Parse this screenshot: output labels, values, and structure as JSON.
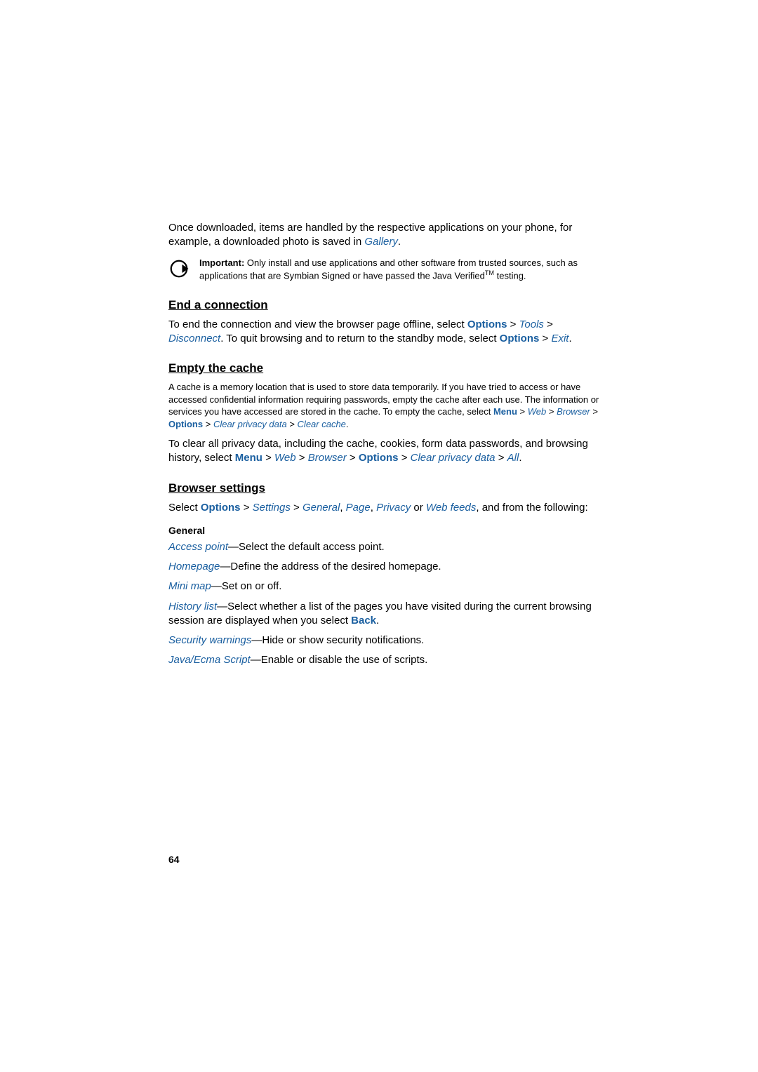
{
  "intro": {
    "line1_pre": "Once downloaded, items are handled by the respective applications on your phone, for example, a downloaded photo is saved in ",
    "gallery": "Gallery",
    "period": "."
  },
  "important_note": {
    "label": "Important:",
    "text": " Only install and use applications and other software from trusted sources, such as applications that are Symbian Signed or have passed the Java Verified",
    "tm": "TM",
    "tail": " testing."
  },
  "end_connection": {
    "heading": "End a connection",
    "pre1": "To end the connection and view the browser page offline, select ",
    "options1": "Options",
    "gt": " > ",
    "tools": "Tools",
    "disconnect": "Disconnect",
    "mid": ". To quit browsing and to return to the standby mode, select ",
    "options2": "Options",
    "exit": "Exit",
    "period": "."
  },
  "empty_cache": {
    "heading": "Empty the cache",
    "para1_pre": "A cache is a memory location that is used to store data temporarily. If you have tried to access or have accessed confidential information requiring passwords, empty the cache after each use. The information or services you have accessed are stored in the cache. To empty the cache, select ",
    "menu": "Menu",
    "web": "Web",
    "browser": "Browser",
    "options": "Options",
    "clear_privacy": "Clear privacy data",
    "clear_cache": "Clear cache",
    "period": ".",
    "para2_pre": "To clear all privacy data, including the cache, cookies, form data passwords, and browsing history, select ",
    "all": "All"
  },
  "browser_settings": {
    "heading": "Browser settings",
    "select": "Select ",
    "options": "Options",
    "settings": "Settings",
    "general": "General",
    "comma": ", ",
    "page": "Page",
    "privacy": "Privacy",
    "or": " or ",
    "web_feeds": "Web feeds",
    "tail": ", and from the following:",
    "general_sub": "General",
    "items": {
      "access_point": {
        "label": "Access point",
        "desc": "—Select the default access point."
      },
      "homepage": {
        "label": "Homepage",
        "desc": "—Define the address of the desired homepage."
      },
      "mini_map": {
        "label": "Mini map",
        "desc": "—Set on or off."
      },
      "history_list": {
        "label": "History list",
        "desc_pre": "—Select whether a list of the pages you have visited during the current browsing session are displayed when you select ",
        "back": "Back",
        "desc_post": "."
      },
      "security_warnings": {
        "label": "Security warnings",
        "desc": "—Hide or show security notifications."
      },
      "java_ecma": {
        "label": "Java/Ecma Script",
        "desc": "—Enable or disable the use of scripts."
      }
    }
  },
  "page_number": "64"
}
